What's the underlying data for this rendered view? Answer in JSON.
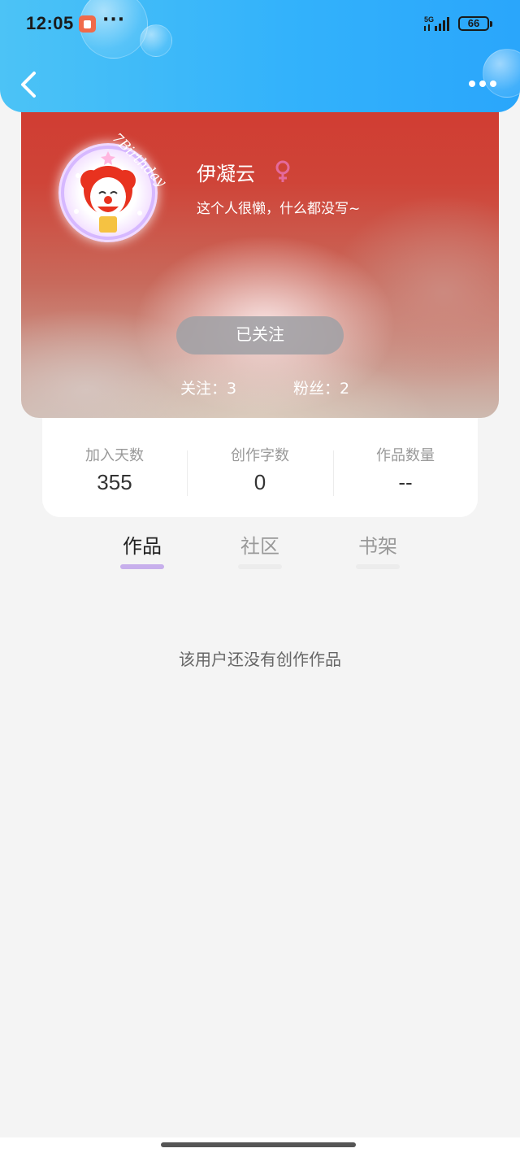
{
  "status_bar": {
    "time": "12:05",
    "network": "5G",
    "battery": "66",
    "more": "···"
  },
  "header": {
    "back_icon": "chevron-left-icon",
    "more_icon": "more-horizontal-icon"
  },
  "profile": {
    "avatar_text": "7Birthday",
    "username": "伊凝云",
    "gender_icon": "female-icon",
    "bio": "这个人很懒，什么都没写~",
    "follow_button": "已关注",
    "following_label": "关注：3",
    "followers_label": "粉丝：2"
  },
  "stats": [
    {
      "label": "加入天数",
      "value": "355"
    },
    {
      "label": "创作字数",
      "value": "0"
    },
    {
      "label": "作品数量",
      "value": "--"
    }
  ],
  "tabs": [
    {
      "label": "作品",
      "active": true
    },
    {
      "label": "社区",
      "active": false
    },
    {
      "label": "书架",
      "active": false
    }
  ],
  "empty_message": "该用户还没有创作作品",
  "colors": {
    "header_start": "#4cc3f6",
    "header_end": "#2aa6fb",
    "tab_indicator_active": "#c7afec",
    "gender_pink": "#e46a9c"
  }
}
